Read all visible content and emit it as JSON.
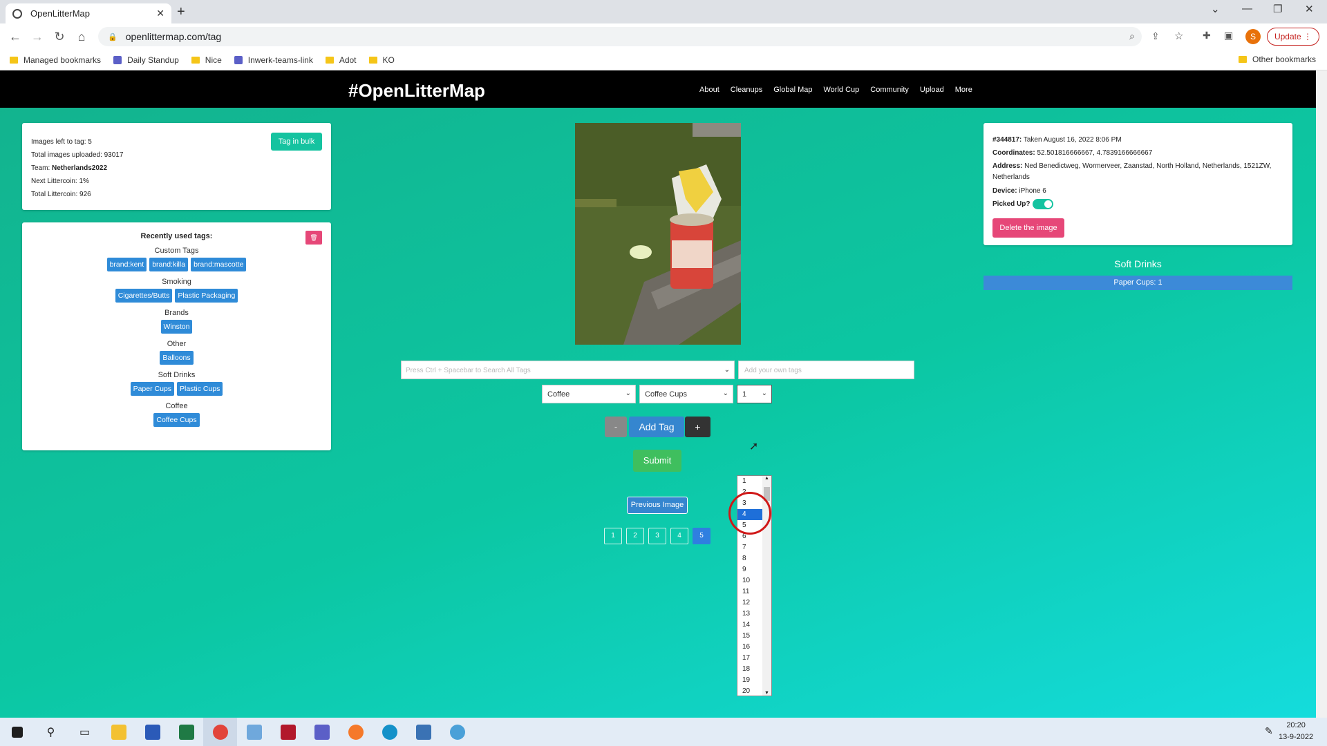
{
  "browser": {
    "tab_title": "OpenLitterMap",
    "url": "openlittermap.com/tag",
    "update_label": "Update",
    "profile_initial": "S",
    "bookmarks": [
      "Managed bookmarks",
      "Daily Standup",
      "Nice",
      "Inwerk-teams-link",
      "Adot",
      "KO"
    ],
    "other_bookmarks": "Other bookmarks"
  },
  "site": {
    "brand": "#OpenLitterMap",
    "nav": [
      "About",
      "Cleanups",
      "Global Map",
      "World Cup",
      "Community",
      "Upload",
      "More"
    ]
  },
  "stats": {
    "images_left": "Images left to tag: 5",
    "total_uploaded": "Total images uploaded: 93017",
    "team_label": "Team: ",
    "team_value": "Netherlands2022",
    "next_littercoin": "Next Littercoin: 1%",
    "total_littercoin": "Total Littercoin: 926",
    "bulk_button": "Tag in bulk"
  },
  "recent": {
    "title": "Recently used tags:",
    "groups": [
      {
        "category": "Custom Tags",
        "tags": [
          "brand:kent",
          "brand:killa",
          "brand:mascotte"
        ]
      },
      {
        "category": "Smoking",
        "tags": [
          "Cigarettes/Butts",
          "Plastic Packaging"
        ]
      },
      {
        "category": "Brands",
        "tags": [
          "Winston"
        ]
      },
      {
        "category": "Other",
        "tags": [
          "Balloons"
        ]
      },
      {
        "category": "Soft Drinks",
        "tags": [
          "Paper Cups",
          "Plastic Cups"
        ]
      },
      {
        "category": "Coffee",
        "tags": [
          "Coffee Cups"
        ]
      }
    ]
  },
  "tagging": {
    "search_placeholder": "Press Ctrl + Spacebar to Search All Tags",
    "own_tags_placeholder": "Add your own tags",
    "category_value": "Coffee",
    "item_value": "Coffee Cups",
    "quantity_value": "1",
    "minus_label": "-",
    "add_tag_label": "Add Tag",
    "plus_label": "+",
    "submit_label": "Submit",
    "previous_label": "Previous Image",
    "pages": [
      "1",
      "2",
      "3",
      "4",
      "5"
    ],
    "active_page": "5",
    "quantity_options": [
      "1",
      "2",
      "3",
      "4",
      "5",
      "6",
      "7",
      "8",
      "9",
      "10",
      "11",
      "12",
      "13",
      "14",
      "15",
      "16",
      "17",
      "18",
      "19",
      "20"
    ],
    "highlighted_option": "4"
  },
  "image_info": {
    "id_label": "#344817:",
    "taken": " Taken August 16, 2022 8:06 PM",
    "coords_label": "Coordinates:",
    "coords_value": " 52.501816666667, 4.7839166666667",
    "address_label": "Address:",
    "address_value": " Ned Benedictweg, Wormerveer, Zaanstad, North Holland, Netherlands, 1521ZW, Netherlands",
    "device_label": "Device:",
    "device_value": " iPhone 6",
    "picked_up_label": "Picked Up?",
    "picked_up": true,
    "delete_label": "Delete the image",
    "summary_category": "Soft Drinks",
    "summary_item": "Paper Cups: 1"
  },
  "taskbar": {
    "time": "20:20",
    "date": "13-9-2022"
  }
}
